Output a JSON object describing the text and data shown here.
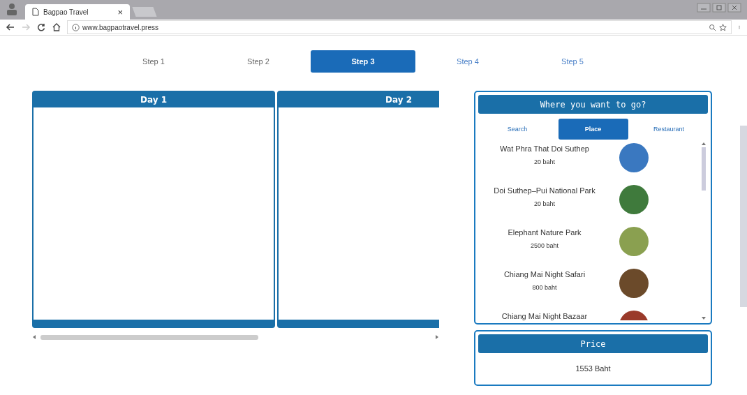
{
  "browser": {
    "tab_title": "Bagpao Travel",
    "tab_close": "×",
    "url": "www.bagpaotravel.press"
  },
  "steps": [
    {
      "label": "Step 1",
      "selected": false,
      "completed": true
    },
    {
      "label": "Step 2",
      "selected": false,
      "completed": true
    },
    {
      "label": "Step 3",
      "selected": true,
      "completed": false
    },
    {
      "label": "Step 4",
      "selected": false,
      "completed": false
    },
    {
      "label": "Step 5",
      "selected": false,
      "completed": false
    }
  ],
  "days": [
    {
      "title": "Day 1"
    },
    {
      "title": "Day 2"
    }
  ],
  "finder": {
    "title": "Where you want to go?",
    "tabs": [
      {
        "label": "Search",
        "selected": false
      },
      {
        "label": "Place",
        "selected": true
      },
      {
        "label": "Restaurant",
        "selected": false
      }
    ],
    "places": [
      {
        "name": "Wat Phra That Doi Suthep",
        "price": "20 baht",
        "color": "#3a78c0"
      },
      {
        "name": "Doi Suthep–Pui National Park",
        "price": "20 baht",
        "color": "#3f7a3c"
      },
      {
        "name": "Elephant Nature Park",
        "price": "2500 baht",
        "color": "#8aa050"
      },
      {
        "name": "Chiang Mai Night Safari",
        "price": "800 baht",
        "color": "#6b4a2a"
      },
      {
        "name": "Chiang Mai Night Bazaar",
        "color": "#9a3a2a"
      }
    ]
  },
  "price": {
    "title": "Price",
    "total": "1553 Baht"
  }
}
